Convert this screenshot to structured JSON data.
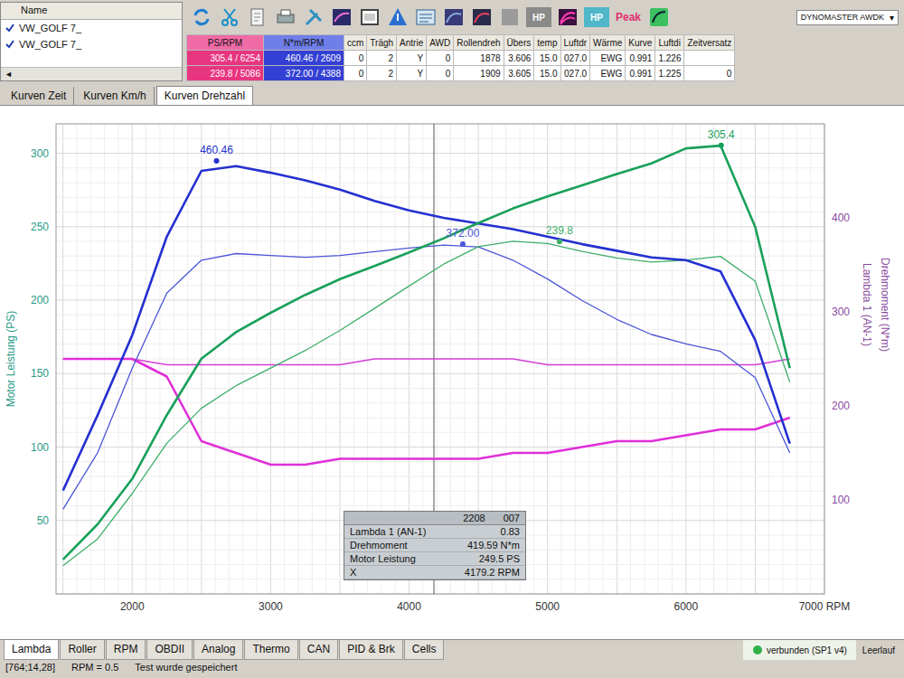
{
  "runs": {
    "header": "Name",
    "scroll_left": "◄",
    "items": [
      {
        "name": "VW_GOLF 7_",
        "checked": true
      },
      {
        "name": "VW_GOLF 7_",
        "checked": true
      }
    ]
  },
  "toolbar": {
    "badges": [
      {
        "text": "HP",
        "kind": "box",
        "color": "#8a8a8a"
      },
      {
        "text": "HP",
        "kind": "box",
        "color": "#4fb7c8"
      },
      {
        "text": "Peak",
        "kind": "text",
        "color": "#e0306e"
      }
    ]
  },
  "device": {
    "value": "DYNOMASTER AWDK",
    "arrow": "▾"
  },
  "results": {
    "columns": [
      "PS/RPM",
      "N*m/RPM",
      "ccm",
      "Trägh",
      "Antrie",
      "AWD",
      "Rollendreh",
      "Übers",
      "temp",
      "Luftdr",
      "Wärme",
      "Kurve",
      "Luftdi",
      "Zeitversatz"
    ],
    "rows": [
      [
        "305.4 / 6254",
        "460.46 / 2609",
        "0",
        "2",
        "Y",
        "0",
        "1878",
        "3.606",
        "15.0",
        "027.0",
        "EWG",
        "0.991",
        "1.226"
      ],
      [
        "239.8 / 5086",
        "372.00 / 4388",
        "0",
        "2",
        "Y",
        "0",
        "1909",
        "3.605",
        "15.0",
        "027.0",
        "EWG",
        "0.991",
        "1.225",
        "0"
      ]
    ]
  },
  "tabs": [
    {
      "label": "Kurven Zeit",
      "selected": false
    },
    {
      "label": "Kurven Km/h",
      "selected": false
    },
    {
      "label": "Kurven Drehzahl",
      "selected": true
    }
  ],
  "chart": {
    "left_axis": {
      "title": "Motor Leistung (PS)",
      "ticks": [
        "50",
        "100",
        "150",
        "200",
        "250",
        "300"
      ]
    },
    "right_axis": {
      "titles": [
        "Lambda 1 (AN-1)",
        "Drehmoment (N*m)"
      ],
      "ticks": [
        "100",
        "200",
        "300",
        "400"
      ]
    },
    "x_axis": {
      "ticks": [
        "2000",
        "3000",
        "4000",
        "5000",
        "6000",
        "7000 RPM"
      ]
    },
    "rpm": [
      1500,
      1750,
      2000,
      2250,
      2500,
      2750,
      3000,
      3250,
      3500,
      3750,
      4000,
      4250,
      4500,
      4750,
      5000,
      5250,
      5500,
      5750,
      6000,
      6250,
      6500,
      6750
    ],
    "series": [
      {
        "axis": "lambda",
        "kind": "stock",
        "color": "#d43fd4",
        "values": [
          1.0,
          1.0,
          1.0,
          0.99,
          0.99,
          0.99,
          0.99,
          0.99,
          0.99,
          1.0,
          1.0,
          1.0,
          1.0,
          1.0,
          0.99,
          0.99,
          0.99,
          0.99,
          0.99,
          0.99,
          0.99,
          1.0
        ]
      },
      {
        "axis": "lambda",
        "kind": "tuned",
        "color": "#e02fd8",
        "values": [
          1.0,
          1.0,
          1.0,
          0.97,
          0.86,
          0.84,
          0.82,
          0.82,
          0.83,
          0.83,
          0.83,
          0.83,
          0.83,
          0.84,
          0.84,
          0.85,
          0.86,
          0.86,
          0.87,
          0.88,
          0.88,
          0.9
        ]
      },
      {
        "axis": "right",
        "kind": "stock",
        "color": "#4b55d8",
        "values": [
          90,
          150,
          240,
          320,
          355,
          362,
          360,
          358,
          360,
          364,
          368,
          371,
          369,
          355,
          335,
          312,
          292,
          276,
          266,
          258,
          230,
          150
        ],
        "peak": {
          "label": "372.00",
          "rpm": 4388
        }
      },
      {
        "axis": "left",
        "kind": "stock",
        "color": "#3fae6a",
        "values": [
          19.2,
          37.4,
          68.3,
          102.5,
          126.4,
          141.7,
          153.8,
          165.7,
          179.4,
          194.4,
          209.6,
          224.5,
          236.4,
          240.1,
          238.5,
          233.2,
          228.7,
          226.0,
          227.2,
          229.8,
          212.9,
          144.2
        ],
        "peak": {
          "label": "239.8",
          "rpm": 5086
        }
      },
      {
        "axis": "right",
        "kind": "tuned",
        "color": "#2430d0",
        "values": [
          110,
          190,
          275,
          380,
          450,
          455,
          448,
          440,
          430,
          418,
          408,
          400,
          394,
          388,
          380,
          372,
          365,
          358,
          355,
          343,
          270,
          160
        ],
        "peak": {
          "label": "460.46",
          "rpm": 2609
        }
      },
      {
        "axis": "left",
        "kind": "tuned",
        "color": "#19a05a",
        "values": [
          23.5,
          47.4,
          78.3,
          121.7,
          160.2,
          178.2,
          191.4,
          203.6,
          214.3,
          223.2,
          232.4,
          242.1,
          252.5,
          262.4,
          270.6,
          278.1,
          285.8,
          293.1,
          303.3,
          305.2,
          249.9,
          153.7
        ],
        "peak": {
          "label": "305.4",
          "rpm": 6254
        }
      }
    ],
    "cursor": {
      "rpm": 4179.2,
      "header": [
        "2208",
        "007"
      ],
      "rows": [
        {
          "label": "Lambda 1 (AN-1)",
          "value": "0.83"
        },
        {
          "label": "Drehmoment",
          "value": "419.59 N*m"
        },
        {
          "label": "Motor Leistung",
          "value": "249.5 PS"
        },
        {
          "label": "X",
          "value": "4179.2 RPM"
        }
      ]
    }
  },
  "bottom_tabs": [
    {
      "label": "Lambda",
      "selected": true
    },
    {
      "label": "Roller",
      "selected": false
    },
    {
      "label": "RPM",
      "selected": false
    },
    {
      "label": "OBDII",
      "selected": false
    },
    {
      "label": "Analog",
      "selected": false
    },
    {
      "label": "Thermo",
      "selected": false
    },
    {
      "label": "CAN",
      "selected": false
    },
    {
      "label": "PID & Brk",
      "selected": false
    },
    {
      "label": "Cells",
      "selected": false
    }
  ],
  "status_bar": {
    "items": [
      "[764;14,28]",
      "RPM = 0.5",
      "Test wurde gespeichert"
    ],
    "connection": {
      "text": "verbunden (SP1 v4)",
      "connected": true
    },
    "mode": "Leerlauf"
  }
}
